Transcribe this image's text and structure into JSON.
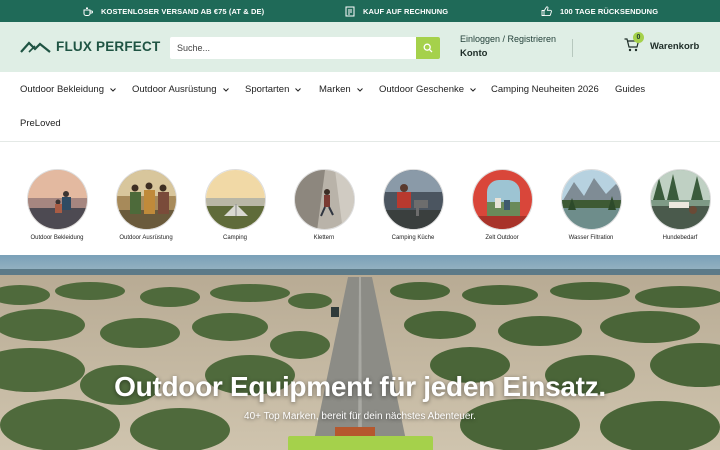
{
  "topbar": {
    "items": [
      {
        "icon": "teapot-icon",
        "text": "KOSTENLOSER VERSAND AB €75 (AT & DE)"
      },
      {
        "icon": "invoice-icon",
        "text": "KAUF AUF RECHNUNG"
      },
      {
        "icon": "thumbs-up-icon",
        "text": "100 TAGE RÜCKSENDUNG"
      }
    ],
    "bg_color": "#1f6a58"
  },
  "header": {
    "logo_text": "FLUX PERFECT",
    "search_placeholder": "Suche...",
    "login_link": "Einloggen / Registrieren",
    "account_label": "Konto",
    "cart_count": "0",
    "cart_label": "Warenkorb",
    "bg_color": "#dfeee5",
    "accent": "#a5d14b"
  },
  "nav": {
    "items": [
      {
        "label": "Outdoor Bekleidung",
        "dropdown": true
      },
      {
        "label": "Outdoor Ausrüstung",
        "dropdown": true
      },
      {
        "label": "Sportarten",
        "dropdown": true
      },
      {
        "label": "Marken",
        "dropdown": true
      },
      {
        "label": "Outdoor Geschenke",
        "dropdown": true
      },
      {
        "label": "Camping Neuheiten 2026",
        "dropdown": false
      },
      {
        "label": "Guides",
        "dropdown": false
      },
      {
        "label": "PreLoved",
        "dropdown": false
      }
    ]
  },
  "categories": [
    {
      "label": "Outdoor Bekleidung"
    },
    {
      "label": "Outdoor Ausrüstung"
    },
    {
      "label": "Camping"
    },
    {
      "label": "Klettern"
    },
    {
      "label": "Camping Küche"
    },
    {
      "label": "Zelt Outdoor"
    },
    {
      "label": "Wasser Filtration"
    },
    {
      "label": "Hundebedarf"
    }
  ],
  "hero": {
    "title": "Outdoor Equipment für jeden Einsatz.",
    "subtitle": "40+ Top Marken, bereit für dein nächstes Abenteuer."
  }
}
